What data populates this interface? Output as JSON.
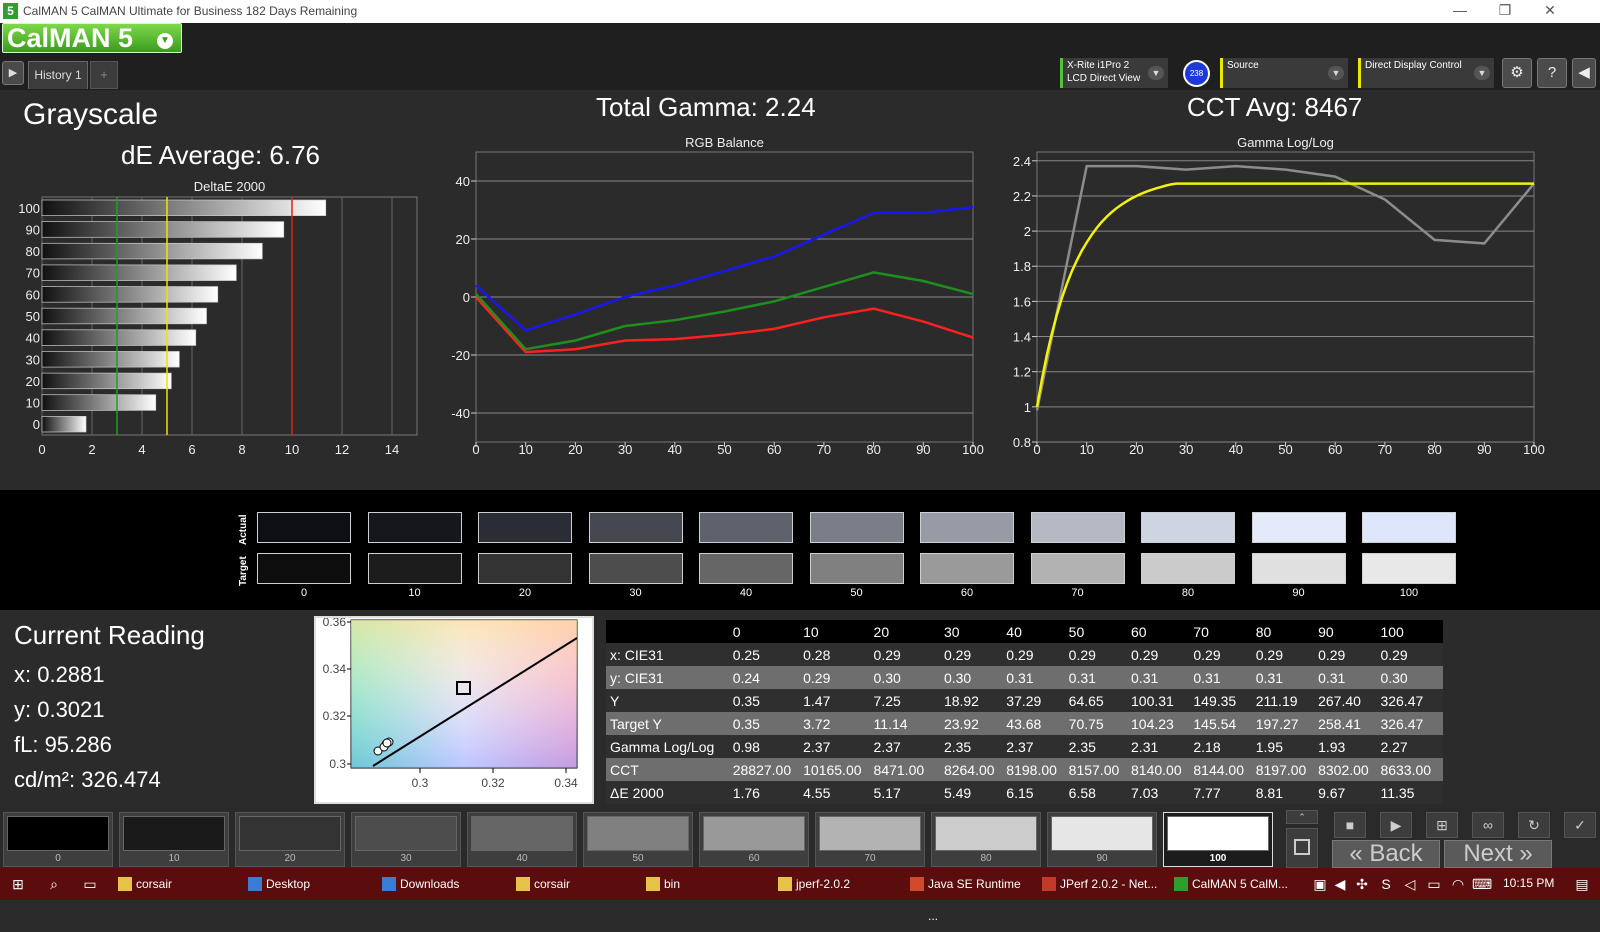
{
  "window": {
    "title": "CalMAN 5 CalMAN Ultimate for Business 182 Days Remaining",
    "icon": "5",
    "min": "—",
    "max": "❐",
    "close": "✕"
  },
  "toolbar": {
    "logo": "CalMAN 5",
    "tab": "History 1",
    "add_tab": "+",
    "meter": {
      "line1": "X-Rite i1Pro 2",
      "line2": "LCD Direct View"
    },
    "badge": "238",
    "source": "Source",
    "display": "Direct Display Control",
    "icons": [
      "play-icon",
      "gear-icon",
      "help-icon",
      "collapse-icon"
    ]
  },
  "grayscale": {
    "title": "Grayscale",
    "de_avg": "dE Average: 6.76",
    "total_gamma": "Total Gamma: 2.24",
    "cct_avg": "CCT Avg: 8467"
  },
  "chart_data": [
    {
      "type": "bar",
      "title": "DeltaE 2000",
      "orientation": "horizontal",
      "categories": [
        "100",
        "90",
        "80",
        "70",
        "60",
        "50",
        "40",
        "30",
        "20",
        "10",
        "0"
      ],
      "values": [
        11.35,
        9.67,
        8.81,
        7.77,
        7.03,
        6.58,
        6.15,
        5.49,
        5.17,
        4.55,
        1.76
      ],
      "xlim": [
        0,
        15
      ],
      "xticks": [
        "0",
        "2",
        "4",
        "6",
        "8",
        "10",
        "12",
        "14"
      ],
      "threshold_lines": [
        {
          "value": 3,
          "color": "#1fa01f"
        },
        {
          "value": 5,
          "color": "#e8e800"
        },
        {
          "value": 10,
          "color": "#e02020"
        }
      ]
    },
    {
      "type": "line",
      "title": "RGB Balance",
      "x": [
        0,
        10,
        20,
        30,
        40,
        50,
        60,
        70,
        80,
        90,
        100
      ],
      "ylim": [
        -50,
        50
      ],
      "yticks": [
        "40",
        "20",
        "0",
        "-20",
        "-40"
      ],
      "xticks": [
        "0",
        "10",
        "20",
        "30",
        "40",
        "50",
        "60",
        "70",
        "80",
        "90",
        "100"
      ],
      "series": [
        {
          "color": "#ff2020",
          "values": [
            0,
            -19,
            -18,
            -15,
            -14.5,
            -13,
            -11,
            -7,
            -4,
            -8.5,
            -14
          ]
        },
        {
          "color": "#1e8f1e",
          "values": [
            1,
            -18,
            -15,
            -10,
            -8,
            -5,
            -1.5,
            3.5,
            8.5,
            5.5,
            1
          ]
        },
        {
          "color": "#1818ee",
          "values": [
            4,
            -11.5,
            -6,
            0,
            4,
            9,
            14,
            21.5,
            29,
            29,
            31
          ]
        }
      ]
    },
    {
      "type": "line",
      "title": "Gamma Log/Log",
      "x": [
        0,
        10,
        20,
        30,
        40,
        50,
        60,
        70,
        80,
        90,
        100
      ],
      "ylim": [
        0.8,
        2.45
      ],
      "yticks": [
        "2.4",
        "2.2",
        "2",
        "1.8",
        "1.6",
        "1.4",
        "1.2",
        "1",
        "0.8"
      ],
      "xticks": [
        "0",
        "10",
        "20",
        "30",
        "40",
        "50",
        "60",
        "70",
        "80",
        "90",
        "100"
      ],
      "series": [
        {
          "color": "#8c8c8c",
          "values": [
            0.98,
            2.37,
            2.37,
            2.35,
            2.37,
            2.35,
            2.31,
            2.18,
            1.95,
            1.93,
            2.27
          ]
        },
        {
          "color": "#f2f20a",
          "values": [
            1.0,
            1.96,
            2.08,
            2.14,
            2.18,
            2.21,
            2.23,
            2.24,
            2.25,
            2.26,
            2.27
          ]
        }
      ]
    }
  ],
  "swatches": {
    "actual_label": "Actual",
    "target_label": "Target",
    "labels": [
      "0",
      "10",
      "20",
      "30",
      "40",
      "50",
      "60",
      "70",
      "80",
      "90",
      "100"
    ],
    "actual": [
      "#0d0f14",
      "#15171d",
      "#2a2d35",
      "#454851",
      "#5e626c",
      "#7a7e89",
      "#979ba6",
      "#b5b9c4",
      "#ced5e2",
      "#e3ebfa",
      "#dde6fb"
    ],
    "target": [
      "#0e0e0e",
      "#1c1c1c",
      "#333333",
      "#4d4d4d",
      "#666666",
      "#808080",
      "#9a9a9a",
      "#b2b2b2",
      "#cbcbcb",
      "#e0e0e0",
      "#e8e8e8"
    ]
  },
  "reading": {
    "title": "Current Reading",
    "x": "x: 0.2881",
    "y": "y: 0.3021",
    "fl": "fL: 95.286",
    "cdm": "cd/m²: 326.474"
  },
  "cie": {
    "yticks": [
      "0.36",
      "0.34",
      "0.32",
      "0.3"
    ],
    "xticks": [
      "0.3",
      "0.32",
      "0.34"
    ]
  },
  "table": {
    "columns": [
      "",
      "0",
      "10",
      "20",
      "30",
      "40",
      "50",
      "60",
      "70",
      "80",
      "90",
      "100"
    ],
    "rows": [
      [
        "x: CIE31",
        "0.25",
        "0.28",
        "0.29",
        "0.29",
        "0.29",
        "0.29",
        "0.29",
        "0.29",
        "0.29",
        "0.29",
        "0.29"
      ],
      [
        "y: CIE31",
        "0.24",
        "0.29",
        "0.30",
        "0.30",
        "0.31",
        "0.31",
        "0.31",
        "0.31",
        "0.31",
        "0.31",
        "0.30"
      ],
      [
        "Y",
        "0.35",
        "1.47",
        "7.25",
        "18.92",
        "37.29",
        "64.65",
        "100.31",
        "149.35",
        "211.19",
        "267.40",
        "326.47"
      ],
      [
        "Target Y",
        "0.35",
        "3.72",
        "11.14",
        "23.92",
        "43.68",
        "70.75",
        "104.23",
        "145.54",
        "197.27",
        "258.41",
        "326.47"
      ],
      [
        "Gamma Log/Log",
        "0.98",
        "2.37",
        "2.37",
        "2.35",
        "2.37",
        "2.35",
        "2.31",
        "2.18",
        "1.95",
        "1.93",
        "2.27"
      ],
      [
        "CCT",
        "28827.00",
        "10165.00",
        "8471.00",
        "8264.00",
        "8198.00",
        "8157.00",
        "8140.00",
        "8144.00",
        "8197.00",
        "8302.00",
        "8633.00"
      ],
      [
        "ΔE 2000",
        "1.76",
        "4.55",
        "5.17",
        "5.49",
        "6.15",
        "6.58",
        "7.03",
        "7.77",
        "8.81",
        "9.67",
        "11.35"
      ]
    ]
  },
  "patches": {
    "labels": [
      "0",
      "10",
      "20",
      "30",
      "40",
      "50",
      "60",
      "70",
      "80",
      "90",
      "100"
    ],
    "colors": [
      "#000000",
      "#1a1a1a",
      "#333333",
      "#4d4d4d",
      "#666666",
      "#808080",
      "#999999",
      "#b3b3b3",
      "#cccccc",
      "#e6e6e6",
      "#ffffff"
    ],
    "selected": "100"
  },
  "nav": {
    "back": "Back",
    "next": "Next"
  },
  "taskbar": {
    "items": [
      "corsair",
      "Desktop",
      "Downloads",
      "corsair",
      "bin",
      "jperf-2.0.2",
      "Java SE Runtime ...",
      "JPerf 2.0.2 - Net...",
      "CalMAN 5 CalM..."
    ],
    "time": "10:15 PM"
  }
}
